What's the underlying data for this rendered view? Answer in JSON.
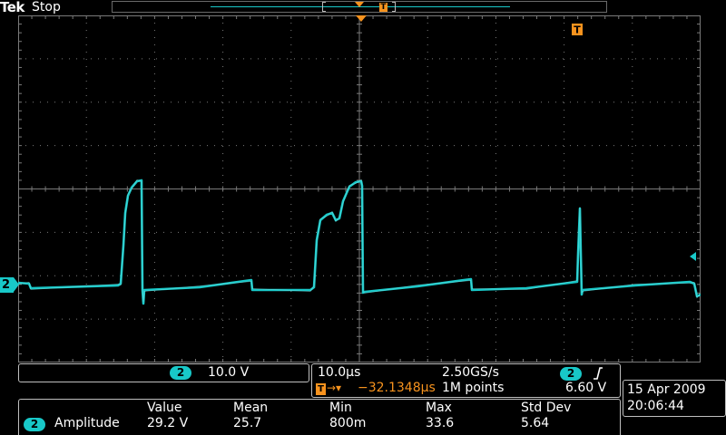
{
  "header": {
    "brand": "Tek",
    "state": "Stop"
  },
  "channel_marker": {
    "label": "2"
  },
  "trigger_markers": {
    "top_t": "T",
    "record_t": "T"
  },
  "scale_panel": {
    "channel": "2",
    "volts_per_div": "10.0 V"
  },
  "timebase_panel": {
    "time_per_div": "10.0µs",
    "sample_rate": "2.50GS/s",
    "trigger_channel": "2",
    "trigger_delay": "−32.1348µs",
    "record_length": "1M points",
    "trigger_level": "6.60 V"
  },
  "datetime": {
    "date": "15 Apr  2009",
    "time": "20:06:44"
  },
  "measurements": {
    "headers": [
      "Value",
      "Mean",
      "Min",
      "Max",
      "Std Dev"
    ],
    "rows": [
      {
        "channel": "2",
        "name": "Amplitude",
        "value": "29.2 V",
        "mean": "25.7",
        "min": "800m",
        "max": "33.6",
        "std_dev": "5.64"
      }
    ]
  },
  "colors": {
    "trace": "#18c8c8",
    "trigger": "#f7931e",
    "grid": "#7a7a7a",
    "background": "#000000"
  }
}
